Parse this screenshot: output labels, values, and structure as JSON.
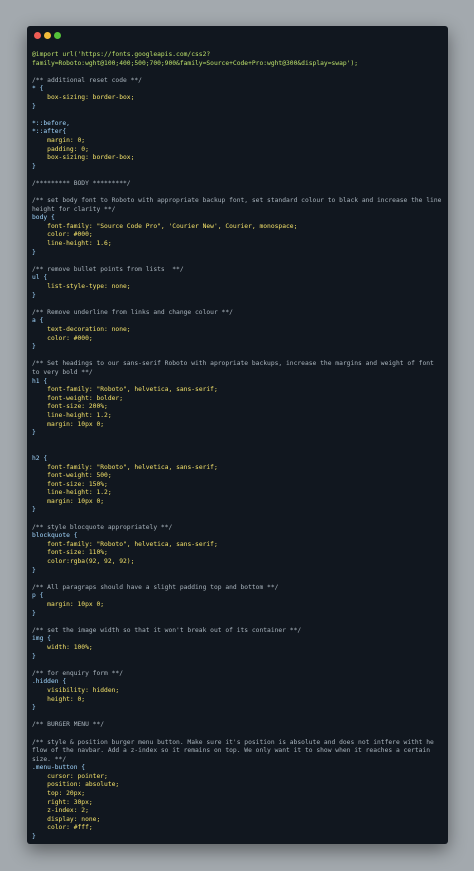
{
  "window": {
    "title_buttons": [
      {
        "name": "close-dot",
        "color": "#ee5c54"
      },
      {
        "name": "minimize-dot",
        "color": "#f2bb3a"
      },
      {
        "name": "maximize-dot",
        "color": "#55c23a"
      }
    ]
  },
  "code_lines": [
    "@import url('https://fonts.googleapis.com/css2?",
    "family=Roboto:wght@100;400;500;700;900&family=Source+Code+Pro:wght@300&display=swap');",
    "",
    "/** additional reset code **/",
    "* {",
    "    box-sizing: border-box;",
    "}",
    "",
    "*::before,",
    "*::after{",
    "    margin: 0;",
    "    padding: 0;",
    "    box-sizing: border-box;",
    "}",
    "",
    "/********* BODY *********/",
    "",
    "/** set body font to Roboto with appropriate backup font, set standard colour to black and increase the line height for clarity **/",
    "body {",
    "    font-family: \"Source Code Pro\", 'Courier New', Courier, monospace;",
    "    color: #000;",
    "    line-height: 1.6;",
    "}",
    "",
    "/** remove bullet points from lists  **/",
    "ul {",
    "    list-style-type: none;",
    "}",
    "",
    "/** Remove underline from links and change colour **/",
    "a {",
    "    text-decoration: none;",
    "    color: #000;",
    "}",
    "",
    "/** Set headings to our sans-serif Roboto with apropriate backups, increase the margins and weight of font to very bold **/",
    "h1 {",
    "    font-family: \"Roboto\", helvetica, sans-serif;",
    "    font-weight: bolder;",
    "    font-size: 200%;",
    "    line-height: 1.2;",
    "    margin: 10px 0;",
    "}",
    "",
    "",
    "h2 {",
    "    font-family: \"Roboto\", helvetica, sans-serif;",
    "    font-weight: 500;",
    "    font-size: 150%;",
    "    line-height: 1.2;",
    "    margin: 10px 0;",
    "}",
    "",
    "/** style blocquote appropriately **/",
    "blockquote {",
    "    font-family: \"Roboto\", helvetica, sans-serif;",
    "    font-size: 110%;",
    "    color:rgba(92, 92, 92);",
    "}",
    "",
    "/** All paragraps should have a slight padding top and bottom **/",
    "p {",
    "    margin: 10px 0;",
    "}",
    "",
    "/** set the image width so that it won't break out of its container **/",
    "img {",
    "    width: 100%;",
    "}",
    "",
    "/** for enquiry form **/",
    ".hidden {",
    "    visibility: hidden;",
    "    height: 0;",
    "}",
    "",
    "/** BURGER MENU **/",
    "",
    "/** style & position burger menu button. Make sure it's position is absolute and does not intfere witht he flow of the navbar. Add a z-index so it remains on top. We only want it to show when it reaches a certain size. **/",
    ".menu-button {",
    "    cursor: pointer;",
    "    position: absolute;",
    "    top: 20px;",
    "    right: 30px;",
    "    z-index: 2;",
    "    display: none;",
    "    color: #fff;",
    "}"
  ]
}
